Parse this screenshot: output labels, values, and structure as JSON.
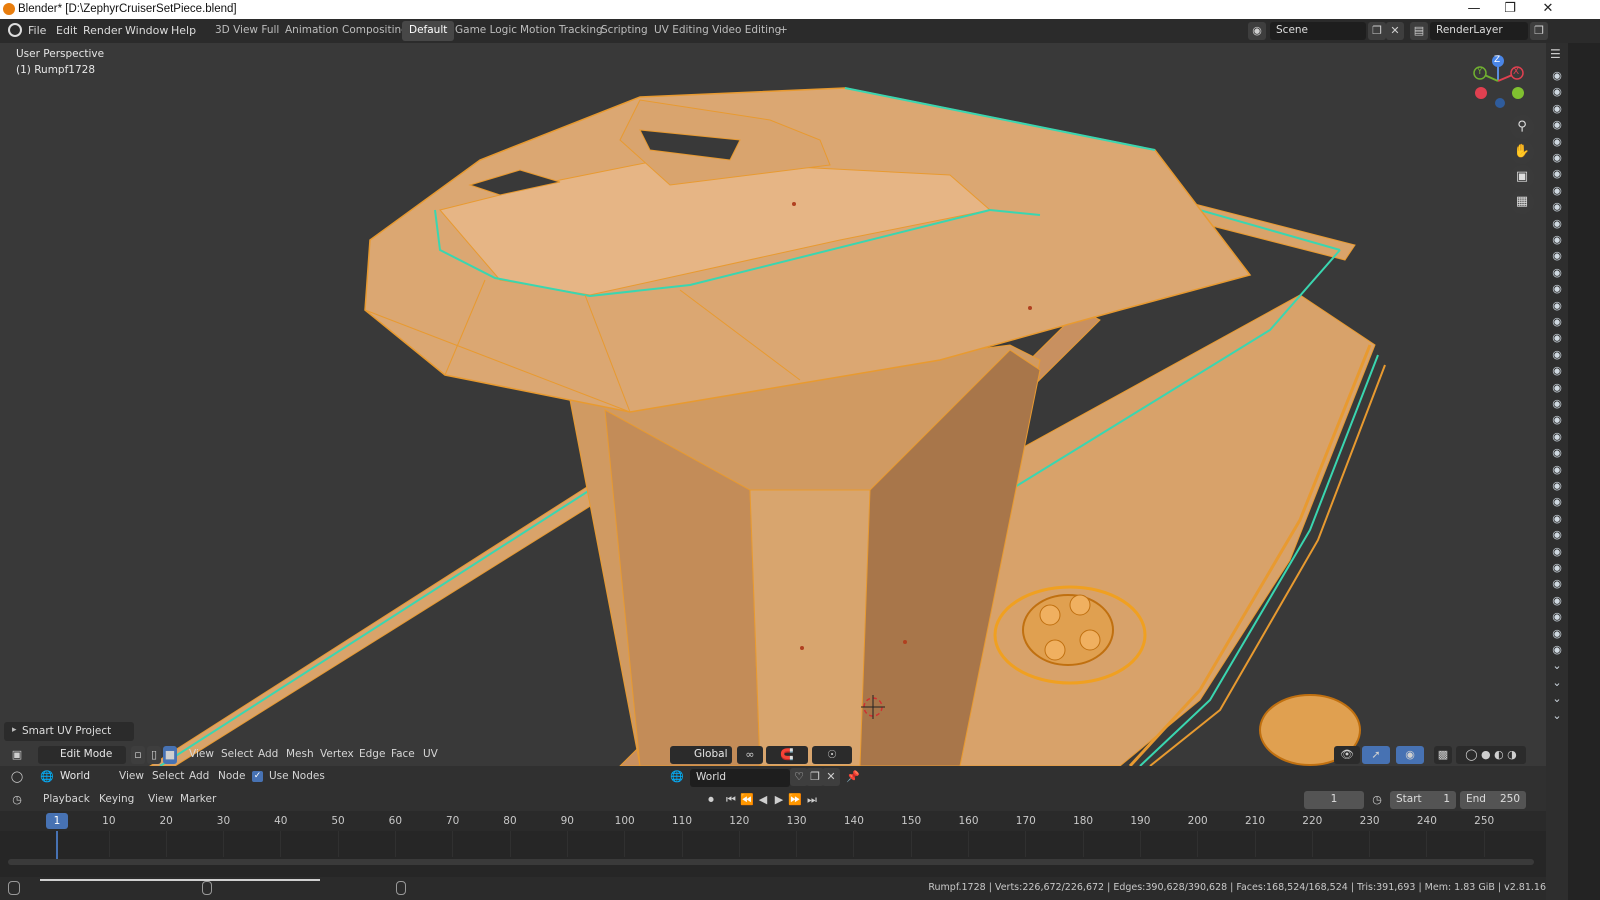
{
  "window": {
    "title": "Blender* [D:\\ZephyrCruiserSetPiece.blend]",
    "minimize": "—",
    "restore": "❐",
    "close": "✕"
  },
  "menubar": {
    "items": [
      "File",
      "Edit",
      "Render",
      "Window",
      "Help"
    ],
    "workspaces": [
      "3D View Full",
      "Animation",
      "Compositing",
      "Default",
      "Game Logic",
      "Motion Tracking",
      "Scripting",
      "UV Editing",
      "Video Editing"
    ],
    "active_workspace": "Default",
    "add_tab": "+",
    "scene": "Scene",
    "render_layer": "RenderLayer"
  },
  "viewport": {
    "view_name": "User Perspective",
    "object_label": "(1) Rumpf1728",
    "operator_panel": "Smart UV Project",
    "gizmo_axes": {
      "x": "X",
      "y": "Y",
      "z": "Z"
    },
    "colors": {
      "mesh": "#d9a36a",
      "edge": "#f0a020",
      "seam": "#3ad6b0",
      "background": "#393939"
    }
  },
  "view3d_header": {
    "mode": "Edit Mode",
    "menus": [
      "View",
      "Select",
      "Add",
      "Mesh",
      "Vertex",
      "Edge",
      "Face",
      "UV"
    ],
    "orientation": "Global"
  },
  "node_header": {
    "world": "World",
    "menus": [
      "View",
      "Select",
      "Add",
      "Node"
    ],
    "use_nodes_label": "Use Nodes",
    "world_field": "World"
  },
  "timeline_header": {
    "menus": [
      "Playback",
      "Keying",
      "View",
      "Marker"
    ],
    "current_frame": "1",
    "start_label": "Start",
    "start": "1",
    "end_label": "End",
    "end": "250"
  },
  "timeline": {
    "current": "1",
    "ticks": [
      "10",
      "20",
      "30",
      "40",
      "50",
      "60",
      "70",
      "80",
      "90",
      "100",
      "110",
      "120",
      "130",
      "140",
      "150",
      "160",
      "170",
      "180",
      "190",
      "200",
      "210",
      "220",
      "230",
      "240",
      "250"
    ]
  },
  "statusbar": {
    "stats": "Rumpf.1728 | Verts:226,672/226,672 | Edges:390,628/390,628 | Faces:168,524/168,524 | Tris:391,693 | Mem: 1.83 GiB | v2.81.16"
  }
}
